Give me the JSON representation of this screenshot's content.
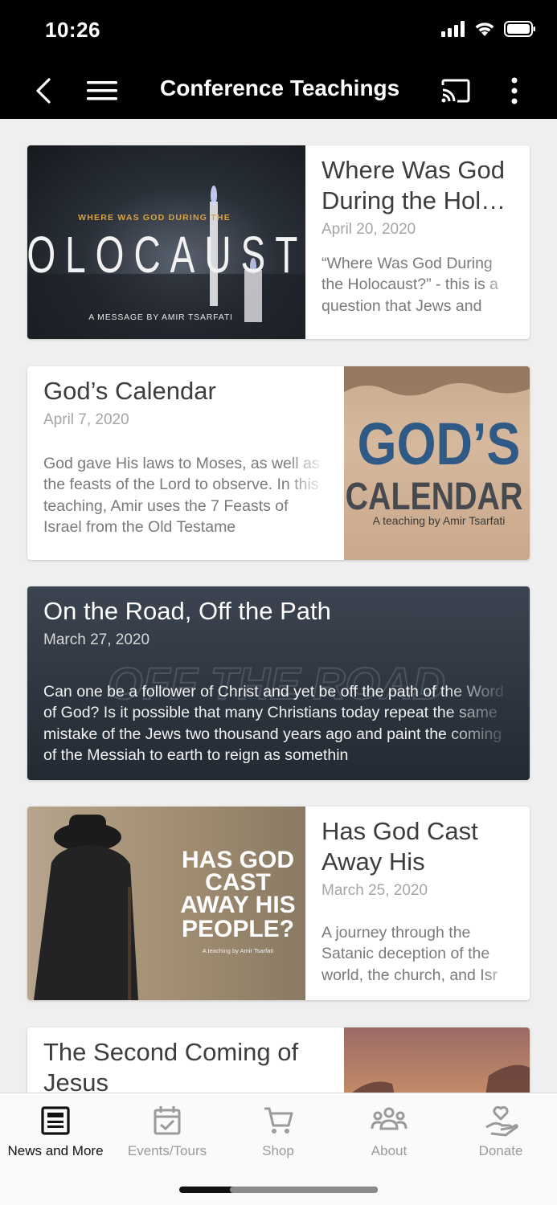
{
  "status_bar": {
    "time": "10:26"
  },
  "app_bar": {
    "title": "Conference Teachings"
  },
  "cards": [
    {
      "title": "Where Was God During the Hol…",
      "date": "April 20, 2020",
      "description": "“Where Was God During the Holocaust?” - this is a question that Jews and",
      "thumb": {
        "top_text": "WHERE WAS GOD DURING THE",
        "main_text": "HOLOCAUST?",
        "bottom_text": "A MESSAGE BY AMIR TSARFATI"
      }
    },
    {
      "title": "God’s Calendar",
      "date": "April 7, 2020",
      "description": "God gave His laws to Moses, as well as the feasts of the Lord to observe. In this teaching, Amir uses the 7 Feasts of Israel from the Old Testame",
      "thumb": {
        "line1": "GOD’S",
        "line2": "CALENDAR",
        "caption": "A teaching by Amir Tsarfati"
      }
    },
    {
      "title": "On the Road, Off the Path",
      "date": "March 27, 2020",
      "description": "Can one be a follower of Christ and yet be off the path of the Word of God? Is it possible that many Christians today repeat the same mistake of the Jews two thousand years ago and paint the coming of the Messiah to earth to reign as somethin",
      "thumb": {
        "bg_text": "OFF THE ROAD"
      }
    },
    {
      "title": "Has God Cast Away His Peopl…",
      "date": "March 25, 2020",
      "description": "A journey through the Satanic deception of the world, the church, and Isr",
      "thumb": {
        "line1": "HAS GOD",
        "line2": "CAST",
        "line3": "AWAY HIS",
        "line4": "PEOPLE?",
        "caption": "A teaching by Amir Tsarfati"
      }
    },
    {
      "title": "The Second Coming of Jesus"
    }
  ],
  "bottom_nav": [
    {
      "label": "News and More",
      "icon": "newspaper-icon",
      "active": true
    },
    {
      "label": "Events/Tours",
      "icon": "calendar-check-icon",
      "active": false
    },
    {
      "label": "Shop",
      "icon": "cart-icon",
      "active": false
    },
    {
      "label": "About",
      "icon": "people-icon",
      "active": false
    },
    {
      "label": "Donate",
      "icon": "donate-hand-icon",
      "active": false
    }
  ],
  "colors": {
    "app_bar_bg": "#000000",
    "page_bg": "#efefef",
    "card_bg": "#ffffff",
    "title_text": "#3d3d3d",
    "date_text": "#a5a5a5",
    "desc_text": "#7a7a7a",
    "nav_active": "#111111",
    "nav_inactive": "#9a9a9a"
  }
}
